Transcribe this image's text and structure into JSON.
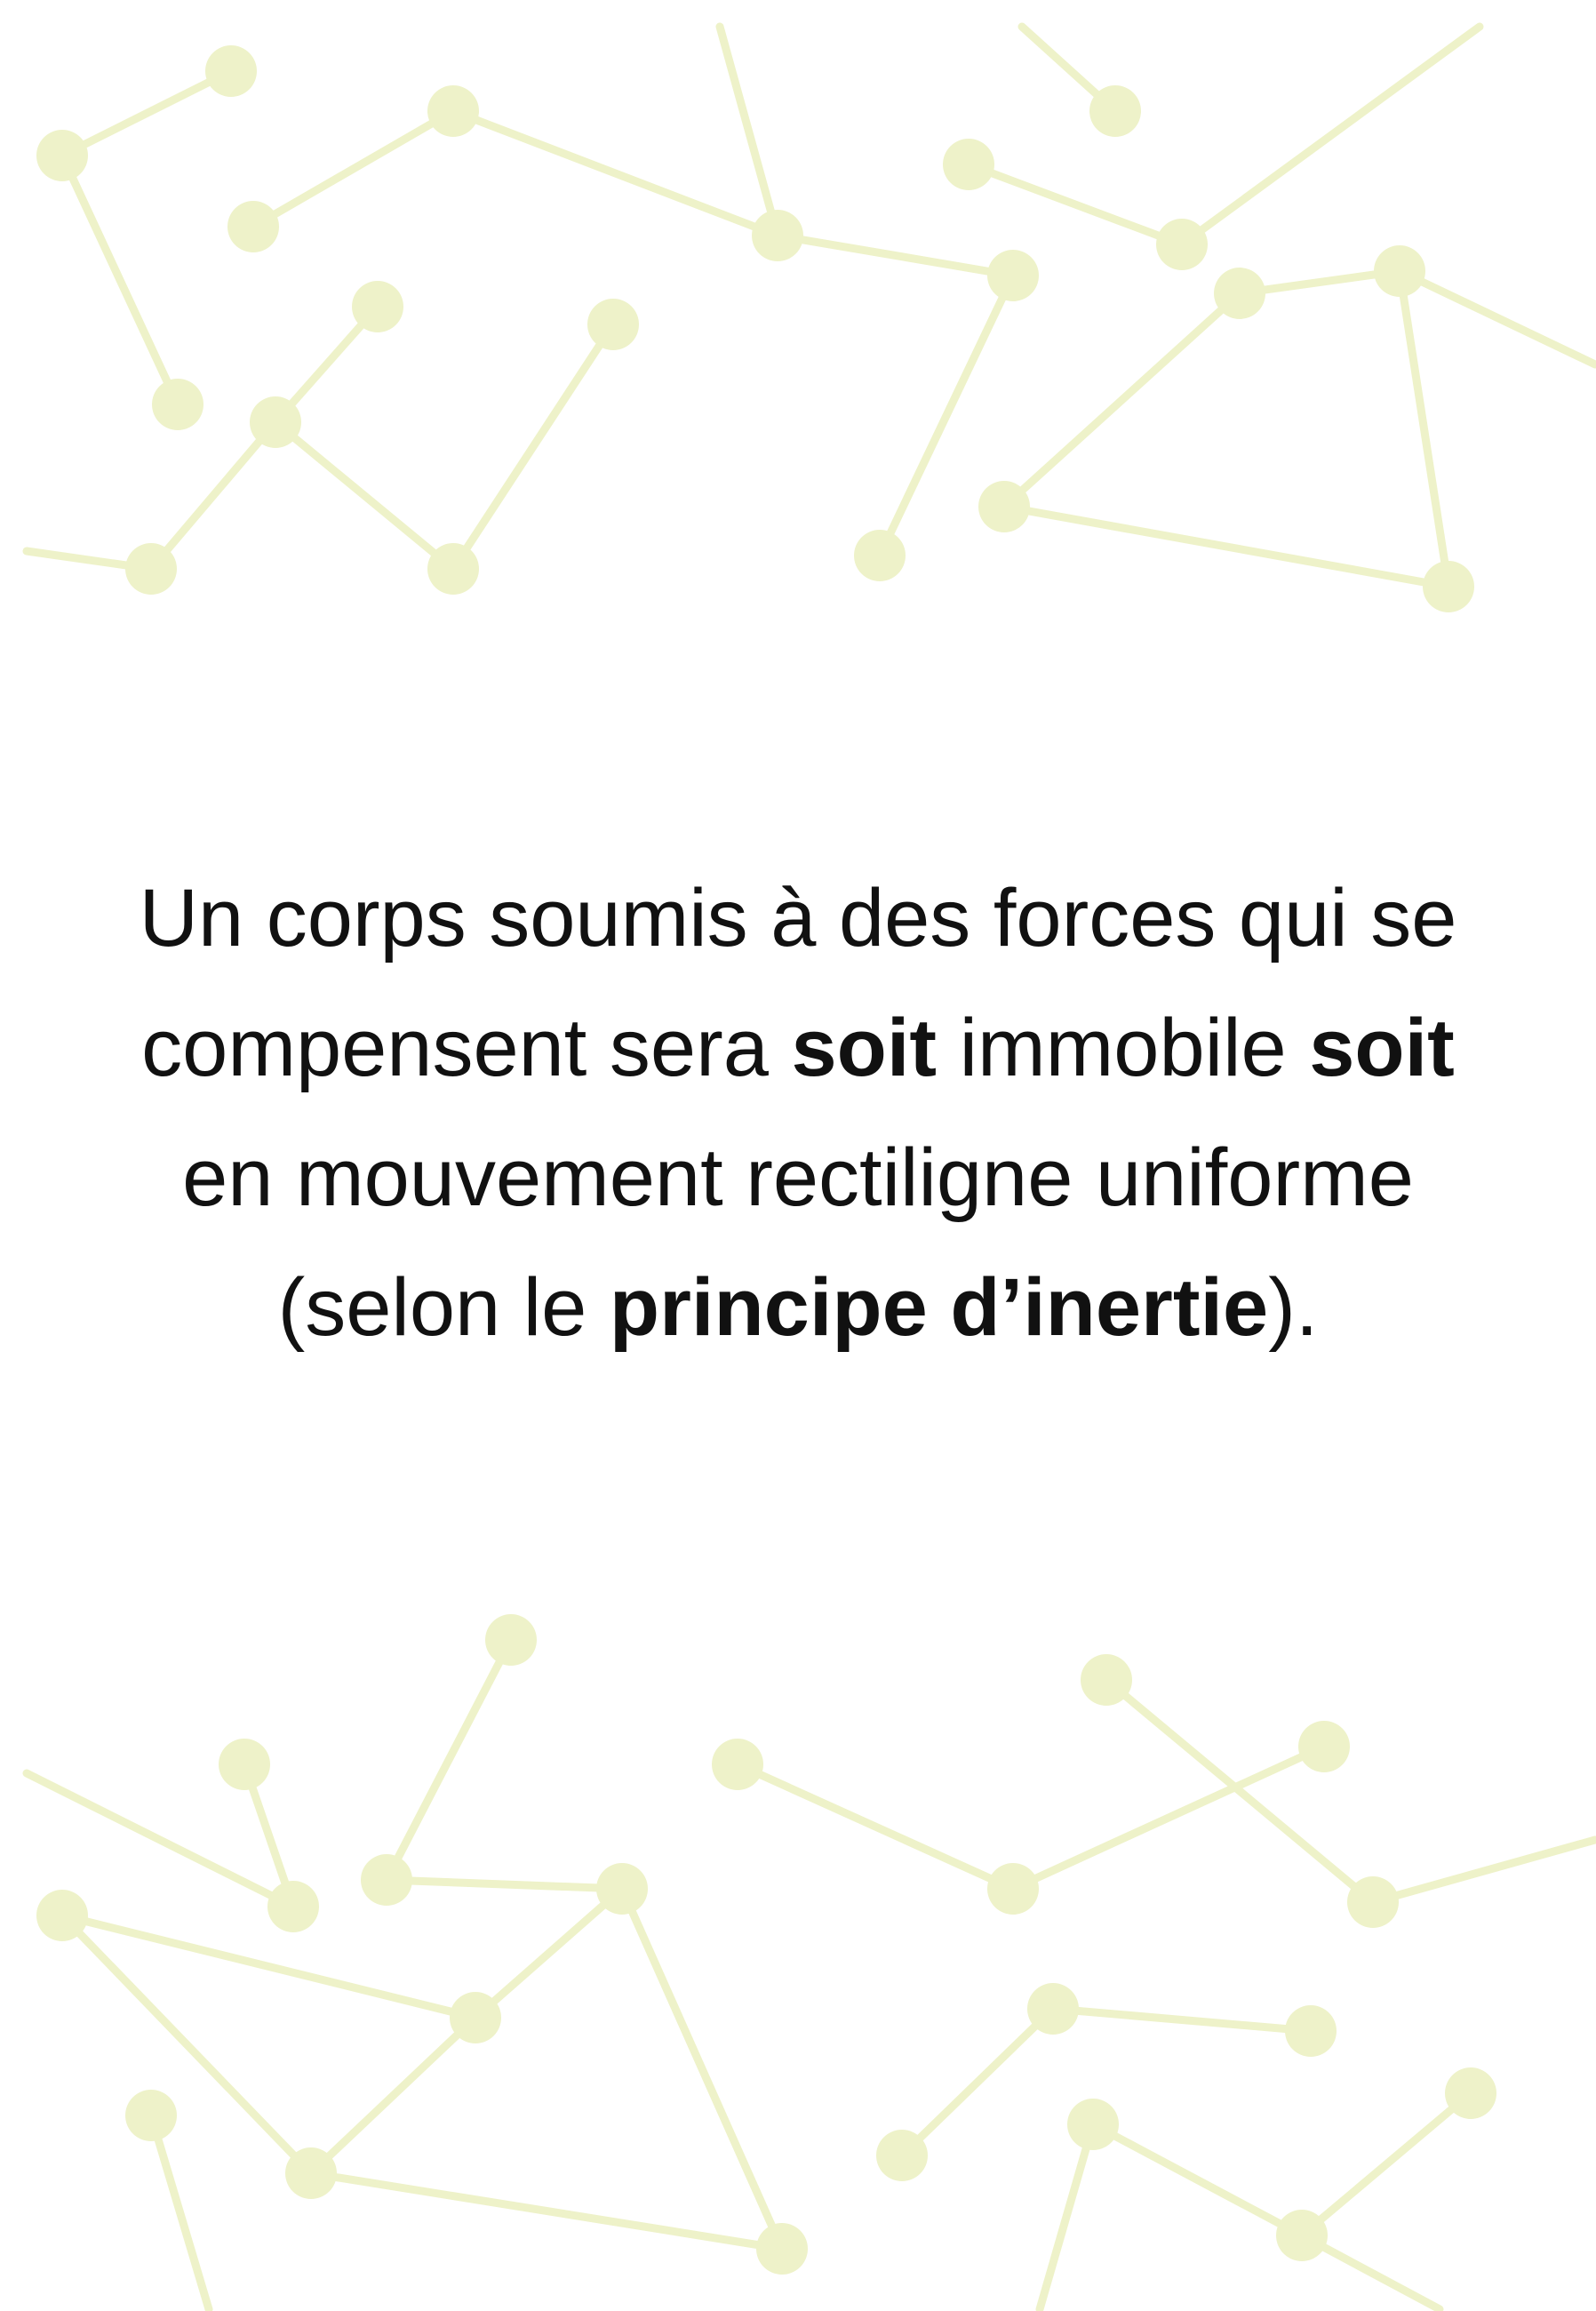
{
  "statement": {
    "part1": "Un corps soumis à des forces qui se compensent sera ",
    "emph1": "soit",
    "part2": " immobile ",
    "emph2": "soit",
    "part3": " en mouvement rectiligne uniforme (selon le ",
    "emph3": "principe d’inertie",
    "part4": ")."
  },
  "colors": {
    "background": "#ffffff",
    "text": "#111111",
    "decoration": "#eef2c9"
  }
}
